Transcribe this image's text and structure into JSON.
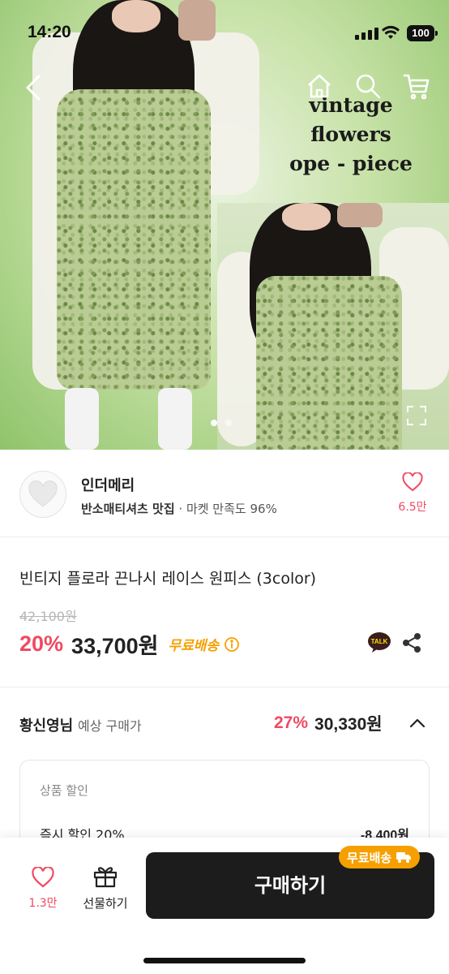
{
  "status": {
    "time": "14:20",
    "battery": "100"
  },
  "hero": {
    "script_lines": [
      "vintage",
      "flowers",
      "ope - piece"
    ],
    "slide_count": 2,
    "active_slide": 1
  },
  "store": {
    "name": "인더메리",
    "category": "반소매티셔츠 맛집",
    "satisfaction": "· 마켓 만족도 96%",
    "likes": "6.5만"
  },
  "product": {
    "title": "빈티지 플로라 끈나시 레이스 원피스 (3color)",
    "original_price": "42,100원",
    "discount": "20%",
    "price": "33,700원",
    "free_shipping": "무료배송",
    "kakao_label": "TALK"
  },
  "expected": {
    "user": "황신영님",
    "label": "예상 구매가",
    "discount": "27%",
    "price": "30,330원"
  },
  "detail": {
    "header": "상품 할인",
    "row_label": "즉시 할인 20%",
    "row_value": "-8,400원"
  },
  "bottom": {
    "likes": "1.3만",
    "gift": "선물하기",
    "buy": "구매하기",
    "free_badge": "무료배송"
  },
  "colors": {
    "accent": "#ef4a62",
    "shipping": "#f5a000",
    "buy_button": "#1c1c1c"
  },
  "icons": [
    "back-icon",
    "home-icon",
    "search-icon",
    "cart-icon",
    "expand-icon",
    "heart-icon",
    "info-icon",
    "kakao-talk-icon",
    "share-icon",
    "chevron-up-icon",
    "gift-icon",
    "truck-icon"
  ]
}
